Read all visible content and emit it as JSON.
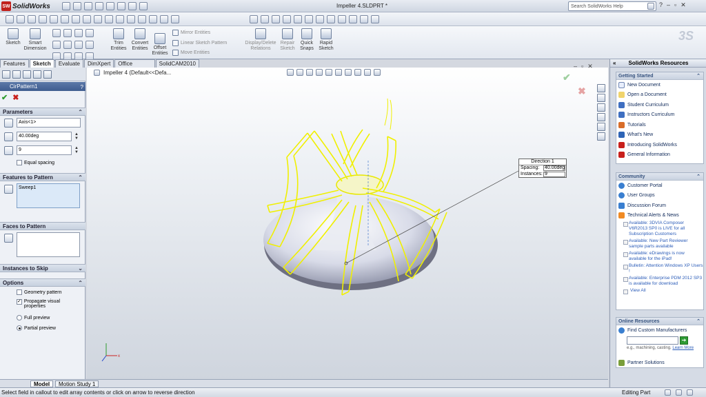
{
  "app": {
    "name": "SolidWorks",
    "window_title": "Impeller 4.SLDPRT *"
  },
  "search": {
    "placeholder": "Search SolidWorks Help"
  },
  "window_controls": {
    "minimize": "–",
    "help": "?",
    "restore": "▫",
    "close": "✕"
  },
  "ribbon": {
    "sketch": "Sketch",
    "smart_dimension": "Smart Dimension",
    "trim_entities": "Trim Entities",
    "convert_entities": "Convert Entities",
    "offset_entities": "Offset Entities",
    "mirror_entities": "Mirror Entities",
    "linear_sketch_pattern": "Linear Sketch Pattern",
    "move_entities": "Move Entities",
    "display_delete_relations": "Display/Delete Relations",
    "repair_sketch": "Repair Sketch",
    "quick_snaps": "Quick Snaps",
    "rapid_sketch": "Rapid Sketch"
  },
  "tabs": [
    "Features",
    "Sketch",
    "Evaluate",
    "DimXpert",
    "Office Products",
    "SolidCAM2010"
  ],
  "active_tab": "Sketch",
  "property_manager": {
    "title": "CirPattern1",
    "help": "?",
    "ok": "✔",
    "cancel": "✖",
    "parameters": {
      "heading": "Parameters",
      "axis": "Axis<1>",
      "angle": "40.00deg",
      "instances": "9",
      "equal_spacing": "Equal spacing"
    },
    "features_to_pattern": {
      "heading": "Features to Pattern",
      "items": [
        "Sweep1"
      ]
    },
    "faces_to_pattern": {
      "heading": "Faces to Pattern"
    },
    "instances_to_skip": {
      "heading": "Instances to Skip"
    },
    "options": {
      "heading": "Options",
      "geometry_pattern": "Geometry pattern",
      "propagate_visual": "Propagate visual properties",
      "full_preview": "Full preview",
      "partial_preview": "Partial preview"
    }
  },
  "viewport": {
    "tree_label": "Impeller 4  (Default<<Defa...",
    "callout": {
      "heading": "Direction 1",
      "spacing_label": "Spacing:",
      "spacing_value": "40.00deg",
      "instances_label": "Instances:",
      "instances_value": "9"
    },
    "confirm_ok": "✔",
    "confirm_cancel": "✖"
  },
  "bottom_tabs": [
    "Model",
    "Motion Study 1"
  ],
  "status": {
    "message": "Select field in callout to edit array contents or click on arrow to reverse direction",
    "mode": "Editing Part"
  },
  "task_pane": {
    "title": "SolidWorks Resources",
    "getting_started": {
      "heading": "Getting Started",
      "items": [
        "New Document",
        "Open a Document",
        "Student Curriculum",
        "Instructors Curriculum",
        "Tutorials",
        "What's New",
        "Introducing SolidWorks",
        "General Information"
      ]
    },
    "community": {
      "heading": "Community",
      "items": [
        "Customer Portal",
        "User Groups",
        "Discussion Forum",
        "Technical Alerts & News"
      ],
      "news": [
        "Available: 3DVIA Composer V6R2013 SP0 is LIVE for all Subscription Customers",
        "Available: New Part Reviewer sample parts available",
        "Available: eDrawings is now available for the iPad!",
        "Bulletin: Attention Windows XP Users !",
        "Available: Enterprise PDM 2012 SP3 is available for download"
      ],
      "view_all": "View All"
    },
    "online_resources": {
      "heading": "Online Resources",
      "find_label": "Find Custom Manufacturers",
      "hint": "e.g., machining, casting.",
      "learn_more": "Learn More",
      "partner": "Partner Solutions"
    }
  },
  "colors": {
    "accent": "#3f5d8f",
    "preview": "#f0f000",
    "ok": "#2e9c2e",
    "cancel": "#c8201c"
  }
}
